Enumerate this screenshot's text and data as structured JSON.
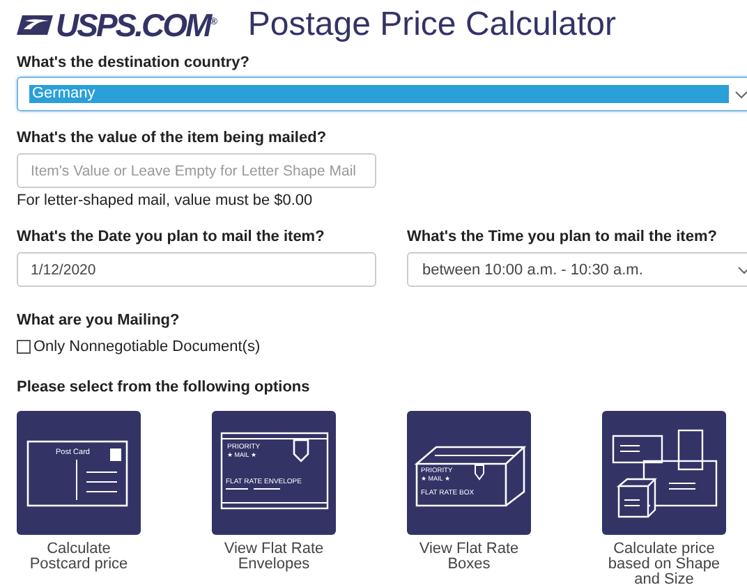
{
  "header": {
    "logo": "USPS.COM$^{®}$",
    "title": "Postage Price Calculator"
  },
  "country": {
    "label": "What's the destination country?",
    "value": "Germany"
  },
  "item_value": {
    "label": "What's the value of the item being mailed?",
    "placeholder": "Item's Value or Leave Empty for Letter Shape Mail",
    "note": "For letter-shaped mail, value must be $0.00"
  },
  "date": {
    "label": "What's the Date you plan to mail the item?",
    "value": "1/12/2020"
  },
  "time": {
    "label": "What's the Time you plan to mail the item?",
    "value": "between 10:00 a.m. - 10:30 a.m."
  },
  "mailing": {
    "label": "What are you Mailing?",
    "option": {
      "label": "Only Nonnegotiable Document(s)",
      "checked": false
    }
  },
  "options": {
    "heading": "Please select from the following options",
    "items": [
      {
        "kind": "postcard",
        "caption": "Calculate Postcard price",
        "art_text": [
          "Post Card"
        ]
      },
      {
        "kind": "envelope",
        "caption": "View Flat Rate Envelopes",
        "art_text": [
          "PRIORITY",
          "★ MAIL ★",
          "FLAT RATE ENVELOPE"
        ]
      },
      {
        "kind": "box",
        "caption": "View Flat Rate Boxes",
        "art_text": [
          "PRIORITY",
          "★ MAIL ★",
          "FLAT RATE BOX"
        ]
      },
      {
        "kind": "shapes",
        "caption": "Calculate price based on Shape and Size"
      }
    ]
  }
}
